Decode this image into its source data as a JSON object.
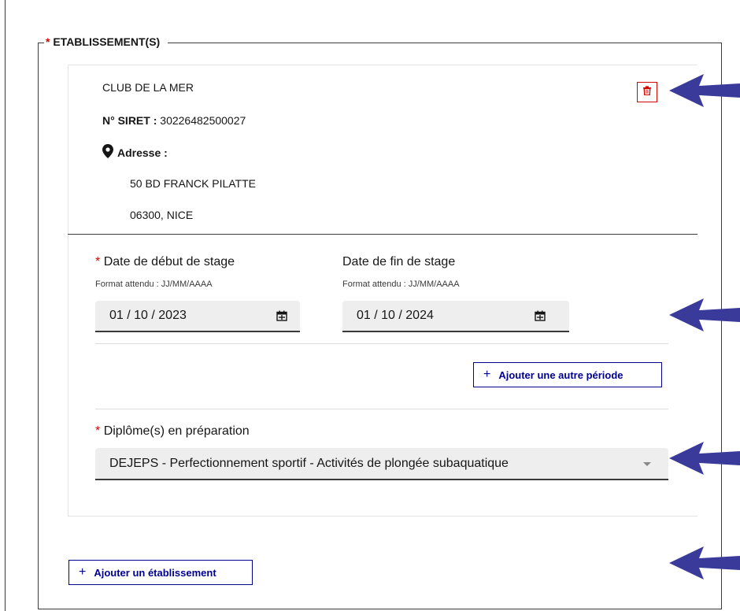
{
  "fieldset": {
    "required_mark": "*",
    "legend": "ETABLISSEMENT(S)"
  },
  "establishment": {
    "name": "CLUB DE LA MER",
    "siret_label": "N° SIRET :",
    "siret_value": "30226482500027",
    "address_label": "Adresse :",
    "address_line1": "50 BD FRANCK PILATTE",
    "address_line2": "06300, NICE"
  },
  "start_date": {
    "required_mark": "*",
    "label": "Date de début de stage",
    "hint": "Format attendu : JJ/MM/AAAA",
    "value": "01 / 10 / 2023"
  },
  "end_date": {
    "label": "Date de fin de stage",
    "hint": "Format attendu : JJ/MM/AAAA",
    "value": "01 / 10 / 2024"
  },
  "add_period_button": {
    "icon": "+",
    "label": "Ajouter une autre période"
  },
  "diploma": {
    "required_mark": "*",
    "label": "Diplôme(s) en préparation",
    "selected": "DEJEPS - Perfectionnement sportif - Activités de plongée subaquatique"
  },
  "add_establishment_button": {
    "icon": "+",
    "label": "Ajouter un établissement"
  },
  "colors": {
    "accent": "#000091",
    "danger": "#ce0500",
    "annotation_arrow": "#3a3a9a"
  }
}
